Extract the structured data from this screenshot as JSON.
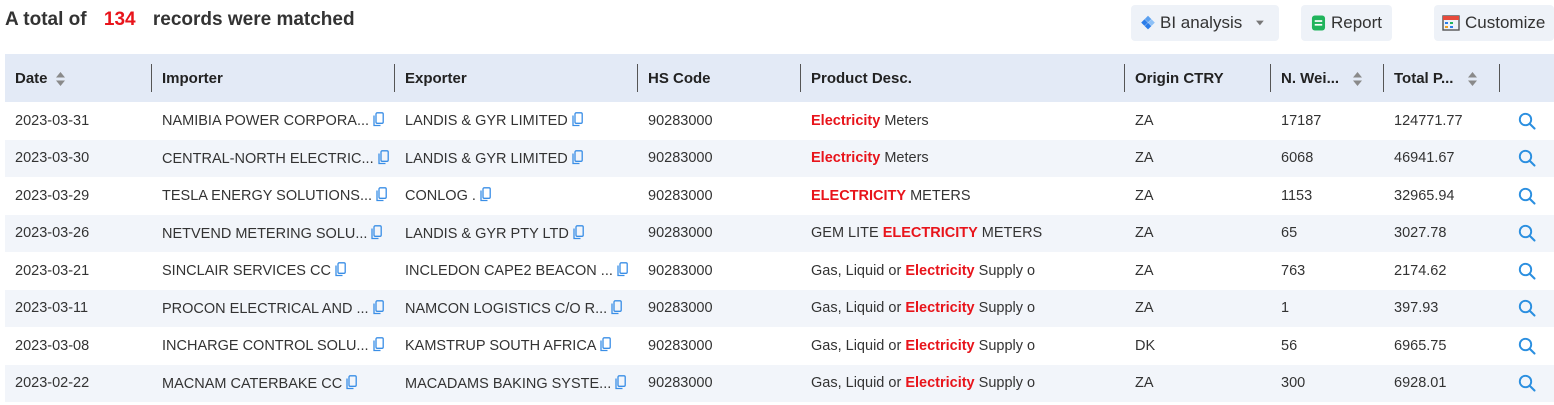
{
  "summary": {
    "prefix": "A total of",
    "count": "134",
    "suffix": "records were matched"
  },
  "toolbar": {
    "bi_label": "BI analysis",
    "report_label": "Report",
    "customize_label": "Customize"
  },
  "columns": [
    "Date",
    "Importer",
    "Exporter",
    "HS Code",
    "Product Desc.",
    "Origin CTRY",
    "N. Wei...",
    "Total P..."
  ],
  "rows": [
    {
      "date": "2023-03-31",
      "importer": "NAMIBIA POWER CORPORA...",
      "exporter": "LANDIS & GYR LIMITED",
      "hs": "90283000",
      "desc_pre": "",
      "desc_hl": "Electricity",
      "desc_post": " Meters",
      "origin": "ZA",
      "weight": "17187",
      "total": "124771.77"
    },
    {
      "date": "2023-03-30",
      "importer": "CENTRAL-NORTH ELECTRIC...",
      "exporter": "LANDIS & GYR LIMITED",
      "hs": "90283000",
      "desc_pre": "",
      "desc_hl": "Electricity",
      "desc_post": " Meters",
      "origin": "ZA",
      "weight": "6068",
      "total": "46941.67"
    },
    {
      "date": "2023-03-29",
      "importer": "TESLA ENERGY SOLUTIONS...",
      "exporter": "CONLOG .",
      "hs": "90283000",
      "desc_pre": "",
      "desc_hl": "ELECTRICITY",
      "desc_post": " METERS",
      "origin": "ZA",
      "weight": "1153",
      "total": "32965.94"
    },
    {
      "date": "2023-03-26",
      "importer": "NETVEND METERING SOLU...",
      "exporter": "LANDIS & GYR PTY LTD",
      "hs": "90283000",
      "desc_pre": "GEM LITE ",
      "desc_hl": "ELECTRICITY",
      "desc_post": " METERS",
      "origin": "ZA",
      "weight": "65",
      "total": "3027.78"
    },
    {
      "date": "2023-03-21",
      "importer": "SINCLAIR SERVICES CC",
      "exporter": "INCLEDON CAPE2 BEACON ...",
      "hs": "90283000",
      "desc_pre": "Gas, Liquid or ",
      "desc_hl": "Electricity",
      "desc_post": " Supply o",
      "origin": "ZA",
      "weight": "763",
      "total": "2174.62"
    },
    {
      "date": "2023-03-11",
      "importer": "PROCON ELECTRICAL AND ...",
      "exporter": "NAMCON LOGISTICS C/O R...",
      "hs": "90283000",
      "desc_pre": "Gas, Liquid or ",
      "desc_hl": "Electricity",
      "desc_post": " Supply o",
      "origin": "ZA",
      "weight": "1",
      "total": "397.93"
    },
    {
      "date": "2023-03-08",
      "importer": "INCHARGE CONTROL SOLU...",
      "exporter": "KAMSTRUP SOUTH AFRICA",
      "hs": "90283000",
      "desc_pre": "Gas, Liquid or ",
      "desc_hl": "Electricity",
      "desc_post": " Supply o",
      "origin": "DK",
      "weight": "56",
      "total": "6965.75"
    },
    {
      "date": "2023-02-22",
      "importer": "MACNAM CATERBAKE CC",
      "exporter": "MACADAMS BAKING SYSTE...",
      "hs": "90283000",
      "desc_pre": "Gas, Liquid or ",
      "desc_hl": "Electricity",
      "desc_post": " Supply o",
      "origin": "ZA",
      "weight": "300",
      "total": "6928.01"
    }
  ],
  "colors": {
    "accent": "#2b7de9",
    "highlight": "#e8141b",
    "header_bg": "#e3eaf6",
    "stripe": "#f2f5fa",
    "copy": "#3a8ee6"
  }
}
